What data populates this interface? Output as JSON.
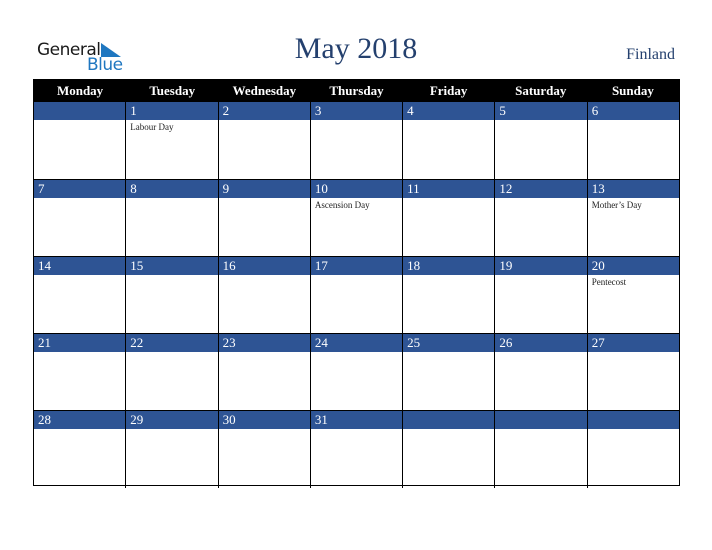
{
  "logo": {
    "line1": "General",
    "line2": "Blue"
  },
  "header": {
    "title": "May 2018",
    "country": "Finland"
  },
  "weekdays": [
    "Monday",
    "Tuesday",
    "Wednesday",
    "Thursday",
    "Friday",
    "Saturday",
    "Sunday"
  ],
  "weeks": [
    [
      {
        "day": "",
        "holiday": ""
      },
      {
        "day": "1",
        "holiday": "Labour Day"
      },
      {
        "day": "2",
        "holiday": ""
      },
      {
        "day": "3",
        "holiday": ""
      },
      {
        "day": "4",
        "holiday": ""
      },
      {
        "day": "5",
        "holiday": ""
      },
      {
        "day": "6",
        "holiday": ""
      }
    ],
    [
      {
        "day": "7",
        "holiday": ""
      },
      {
        "day": "8",
        "holiday": ""
      },
      {
        "day": "9",
        "holiday": ""
      },
      {
        "day": "10",
        "holiday": "Ascension Day"
      },
      {
        "day": "11",
        "holiday": ""
      },
      {
        "day": "12",
        "holiday": ""
      },
      {
        "day": "13",
        "holiday": "Mother’s Day"
      }
    ],
    [
      {
        "day": "14",
        "holiday": ""
      },
      {
        "day": "15",
        "holiday": ""
      },
      {
        "day": "16",
        "holiday": ""
      },
      {
        "day": "17",
        "holiday": ""
      },
      {
        "day": "18",
        "holiday": ""
      },
      {
        "day": "19",
        "holiday": ""
      },
      {
        "day": "20",
        "holiday": "Pentecost"
      }
    ],
    [
      {
        "day": "21",
        "holiday": ""
      },
      {
        "day": "22",
        "holiday": ""
      },
      {
        "day": "23",
        "holiday": ""
      },
      {
        "day": "24",
        "holiday": ""
      },
      {
        "day": "25",
        "holiday": ""
      },
      {
        "day": "26",
        "holiday": ""
      },
      {
        "day": "27",
        "holiday": ""
      }
    ],
    [
      {
        "day": "28",
        "holiday": ""
      },
      {
        "day": "29",
        "holiday": ""
      },
      {
        "day": "30",
        "holiday": ""
      },
      {
        "day": "31",
        "holiday": ""
      },
      {
        "day": "",
        "holiday": ""
      },
      {
        "day": "",
        "holiday": ""
      },
      {
        "day": "",
        "holiday": ""
      }
    ]
  ],
  "colors": {
    "title": "#24406e",
    "band": "#2e5494",
    "header_bg": "#000000",
    "logo_blue": "#1f77c0"
  }
}
